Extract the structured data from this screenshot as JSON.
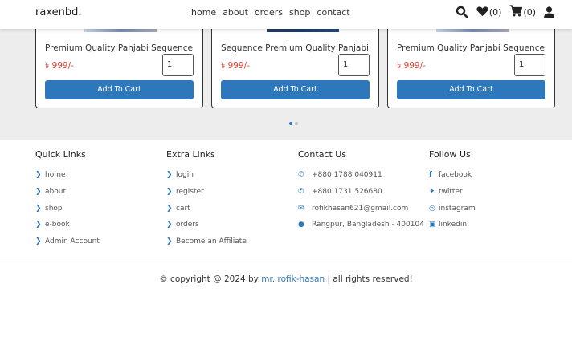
{
  "header": {
    "logo": "raxenbd.",
    "nav": [
      "home",
      "about",
      "orders",
      "shop",
      "contact"
    ],
    "wishlist_count": "(0)",
    "cart_count": "(0)"
  },
  "products": [
    {
      "name": "Premium Quality Panjabi Sequence",
      "price": "৳ 999/-",
      "qty": "1",
      "button": "Add To Cart"
    },
    {
      "name": "Sequence Premium Quality Panjabi",
      "price": "৳ 999/-",
      "qty": "1",
      "button": "Add To Cart"
    },
    {
      "name": "Premium Quality Panjabi Sequence",
      "price": "৳ 999/-",
      "qty": "1",
      "button": "Add To Cart"
    }
  ],
  "footer": {
    "quick_links": {
      "title": "Quick Links",
      "items": [
        "home",
        "about",
        "shop",
        "e-book",
        "Admin Account"
      ]
    },
    "extra_links": {
      "title": "Extra Links",
      "items": [
        "login",
        "register",
        "cart",
        "orders",
        "Become an Affiliate"
      ]
    },
    "contact": {
      "title": "Contact Us",
      "items": [
        "+880 1788 040911",
        "+880 1731 526680",
        "rofikhasan621@gmail.com",
        "Rangpur, Bangladesh - 400104"
      ]
    },
    "follow": {
      "title": "Follow Us",
      "items": [
        "facebook",
        "twitter",
        "instagram",
        "linkedin"
      ]
    }
  },
  "copyright": {
    "prefix": "© copyright @ 2024 by ",
    "author": "mr. rofik-hasan",
    "suffix": " | all rights reserved!"
  },
  "colors": {
    "accent": "#2e77bb",
    "price": "#e2402f"
  }
}
